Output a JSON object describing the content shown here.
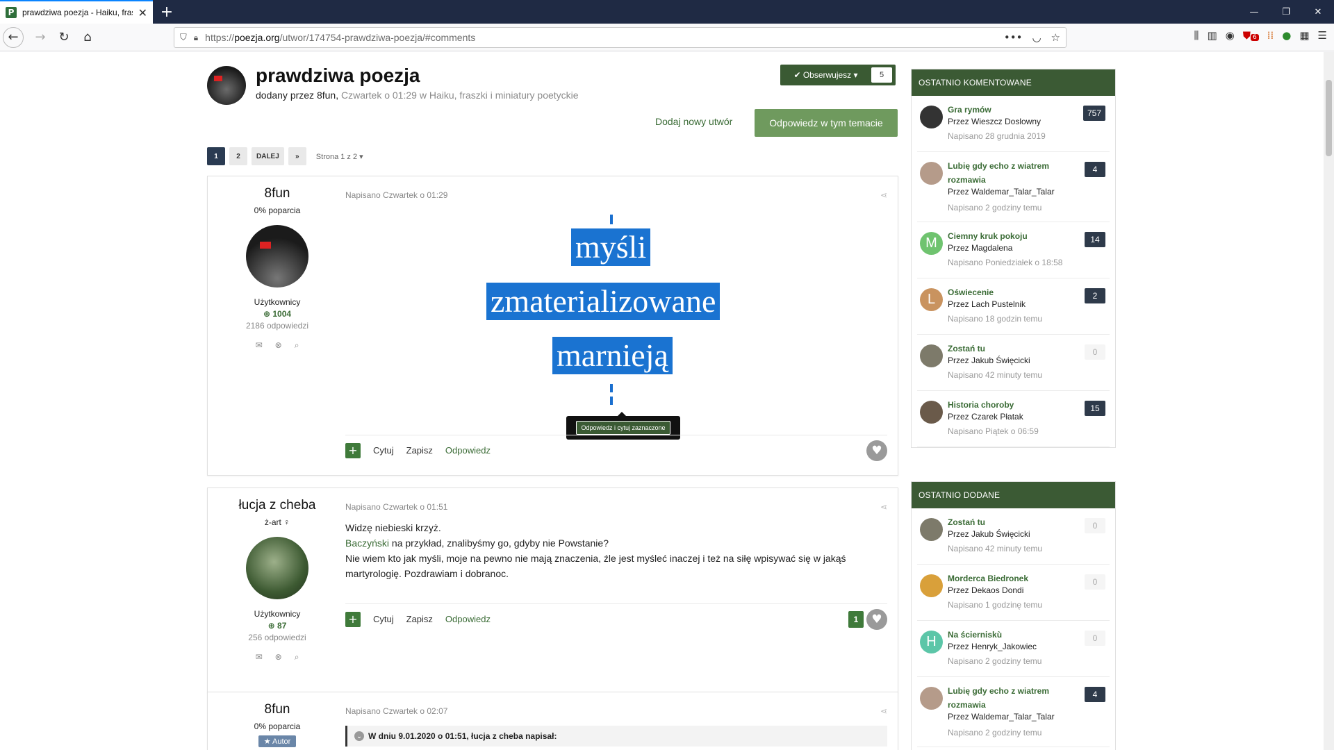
{
  "browser": {
    "tab_title": "prawdziwa poezja - Haiku, frasz",
    "favicon_letter": "P",
    "url_prefix": "https://",
    "url_domain": "poezja.org",
    "url_path": "/utwor/174754-prawdziwa-poezja/#comments",
    "ext_badge": "6"
  },
  "header": {
    "title": "prawdziwa poezja",
    "meta_prefix": "dodany przez 8fun,",
    "meta_date": "Czwartek o 01:29",
    "meta_in": "w",
    "meta_category": "Haiku, fraszki i miniatury poetyckie",
    "follow_label": "✔ Obserwujesz ▾",
    "follow_count": "5"
  },
  "actions": {
    "add_new": "Dodaj nowy utwór",
    "reply": "Odpowiedz w tym temacie"
  },
  "pagination": {
    "pages": [
      "1",
      "2"
    ],
    "next": "DALEJ",
    "last": "»",
    "info": "Strona 1 z 2 ▾"
  },
  "posts": [
    {
      "author": "8fun",
      "sub": "0% poparcia",
      "group": "Użytkownicy",
      "rep": "1004",
      "count": "2186 odpowiedzi",
      "date": "Napisano Czwartek o 01:29",
      "poem": [
        "myśli",
        "zmaterializowane",
        "marnieją"
      ],
      "tooltip": "Odpowiedz i cytuj zaznaczone",
      "quote": "Cytuj",
      "save": "Zapisz",
      "reply": "Odpowiedz"
    },
    {
      "author": "łucja z cheba",
      "sub": "ż-art ♀",
      "group": "Użytkownicy",
      "rep": "87",
      "count": "256 odpowiedzi",
      "date": "Napisano Czwartek o 01:51",
      "text1": "Widzę niebieski krzyż.",
      "text2_link": "Baczyński",
      "text2_rest": " na przykład, znalibyśmy go, gdyby nie Powstanie?",
      "text3": "Nie wiem kto jak myśli, moje na pewno nie mają znaczenia, źle jest myśleć inaczej i też na siłę wpisywać się w jakąś martyrologię. Pozdrawiam i dobranoc.",
      "quote": "Cytuj",
      "save": "Zapisz",
      "reply": "Odpowiedz",
      "likes": "1"
    },
    {
      "author": "8fun",
      "sub": "0% poparcia",
      "badge": "★ Autor",
      "date": "Napisano Czwartek o 02:07",
      "quote_header": "W dniu 9.01.2020 o 01:51, łucja z cheba napisał:"
    }
  ],
  "sidebar": {
    "recent_comments": {
      "title": "Ostatnio komentowane",
      "items": [
        {
          "title": "Gra rymów",
          "author": "Przez Wieszcz Doslowny",
          "date": "Napisano 28 grudnia 2019",
          "count": "757",
          "letter": "",
          "color": "#333333"
        },
        {
          "title": "Lubię gdy echo z wiatrem rozmawia",
          "author": "Przez Waldemar_Talar_Talar",
          "date": "Napisano 2 godziny temu",
          "count": "4",
          "letter": "",
          "color": "#b59b8a"
        },
        {
          "title": "Ciemny kruk pokoju",
          "author": "Przez Magdalena",
          "date": "Napisano Poniedziałek o 18:58",
          "count": "14",
          "letter": "M",
          "color": "#6fc36f"
        },
        {
          "title": "Oświecenie",
          "author": "Przez Lach Pustelnik",
          "date": "Napisano 18 godzin temu",
          "count": "2",
          "letter": "L",
          "color": "#c9935f"
        },
        {
          "title": "Zostań tu",
          "author": "Przez Jakub Święcicki",
          "date": "Napisano 42 minuty temu",
          "count": "0",
          "letter": "",
          "color": "#7d7a6a"
        },
        {
          "title": "Historia choroby",
          "author": "Przez Czarek Płatak",
          "date": "Napisano Piątek o 06:59",
          "count": "15",
          "letter": "",
          "color": "#6a5a4a"
        }
      ]
    },
    "recent_added": {
      "title": "Ostatnio dodane",
      "items": [
        {
          "title": "Zostań tu",
          "author": "Przez Jakub Święcicki",
          "date": "Napisano 42 minuty temu",
          "count": "0",
          "letter": "",
          "color": "#7d7a6a"
        },
        {
          "title": "Morderca Biedronek",
          "author": "Przez Dekaos Dondi",
          "date": "Napisano 1 godzinę temu",
          "count": "0",
          "letter": "",
          "color": "#d9a03a"
        },
        {
          "title": "Na ścierniskù",
          "author": "Przez Henryk_Jakowiec",
          "date": "Napisano 2 godziny temu",
          "count": "0",
          "letter": "H",
          "color": "#5cc6a8"
        },
        {
          "title": "Lubię gdy echo z wiatrem rozmawia",
          "author": "Przez Waldemar_Talar_Talar",
          "date": "Napisano 2 godziny temu",
          "count": "4",
          "letter": "",
          "color": "#b59b8a"
        }
      ]
    }
  },
  "icons": {
    "back": "back-arrow-icon",
    "forward": "forward-arrow-icon",
    "reload": "reload-icon",
    "home": "home-icon",
    "mail": "mail-icon",
    "badge": "badge-icon",
    "search": "search-icon",
    "share": "share-icon",
    "heart": "heart-icon"
  }
}
